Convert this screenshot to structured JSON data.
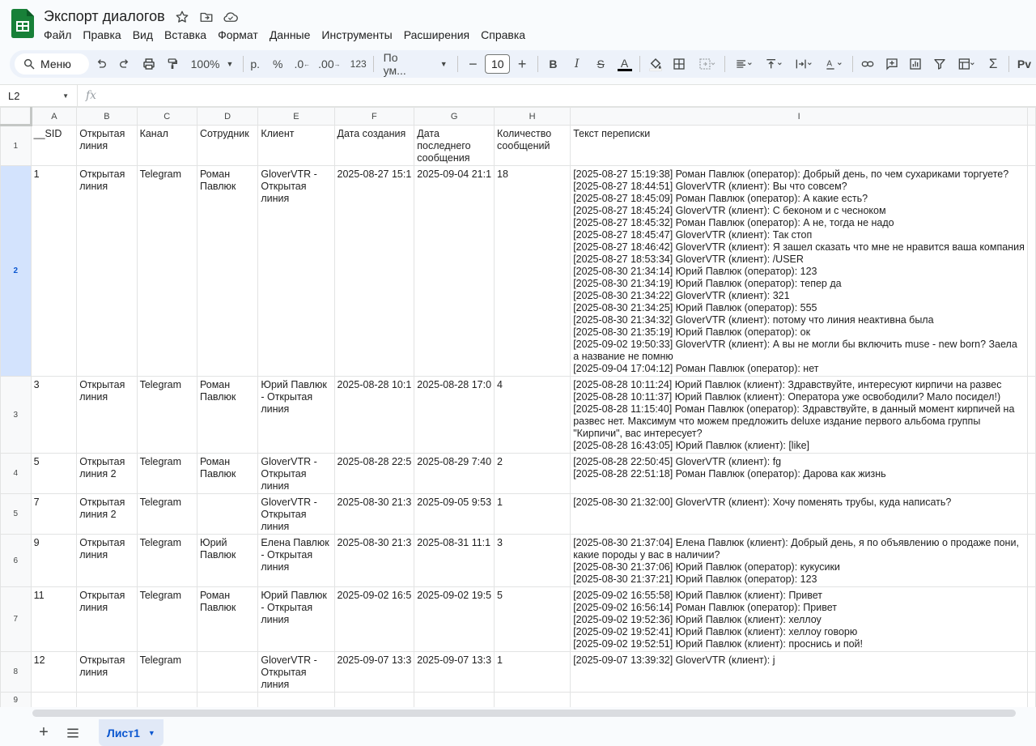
{
  "app": {
    "doc_title": "Экспорт диалогов",
    "brand_color": "#188038"
  },
  "menu": [
    "Файл",
    "Правка",
    "Вид",
    "Вставка",
    "Формат",
    "Данные",
    "Инструменты",
    "Расширения",
    "Справка"
  ],
  "toolbar": {
    "search_label": "Меню",
    "zoom": "100%",
    "currency": "р.",
    "percent": "%",
    "dec_decrease": ".0",
    "dec_increase": ".00",
    "number_format": "123",
    "font_name": "По ум...",
    "font_size": "10"
  },
  "formula_bar": {
    "cell_ref": "L2",
    "fx": "fx"
  },
  "columns": [
    "A",
    "B",
    "C",
    "D",
    "E",
    "F",
    "G",
    "H",
    "I"
  ],
  "header_row": {
    "row_num": "1",
    "cells": [
      "__SID",
      "Открытая линия",
      "Канал",
      "Сотрудник",
      "Клиент",
      "Дата создания",
      "Дата последнего сообщения",
      "Количество сообщений",
      "Текст переписки"
    ]
  },
  "rows": [
    {
      "row_num": "2",
      "sid": "1",
      "line": "Открытая линия",
      "channel": "Telegram",
      "employee": "Роман Павлюк",
      "client": "GloverVTR - Открытая линия",
      "created": "2025-08-27 15:1",
      "last": "2025-09-04 21:1",
      "count": "18",
      "text": [
        "[2025-08-27 15:19:38] Роман Павлюк (оператор): Добрый день, по чем сухариками торгуете?",
        "[2025-08-27 18:44:51] GloverVTR (клиент): Вы что совсем?",
        "[2025-08-27 18:45:09] Роман Павлюк (оператор): А какие есть?",
        "[2025-08-27 18:45:24] GloverVTR (клиент): С беконом и с чесноком",
        "[2025-08-27 18:45:32] Роман Павлюк (оператор): А не, тогда не надо",
        "[2025-08-27 18:45:47] GloverVTR (клиент): Так стоп",
        "[2025-08-27 18:46:42] GloverVTR (клиент): Я зашел сказать что мне не нравится ваша компания",
        "[2025-08-27 18:53:34] GloverVTR (клиент): /USER",
        "[2025-08-30 21:34:14] Юрий Павлюк (оператор): 123",
        "[2025-08-30 21:34:19] Юрий Павлюк (оператор): тепер да",
        "[2025-08-30 21:34:22] GloverVTR (клиент): 321",
        "[2025-08-30 21:34:25] Юрий Павлюк (оператор): 555",
        "[2025-08-30 21:34:32] GloverVTR (клиент): потому что линия неактивна была",
        "[2025-08-30 21:35:19] Юрий Павлюк (оператор): ок",
        "[2025-09-02 19:50:33] GloverVTR (клиент): А вы не могли бы включить muse - new born? Заела а название не помню",
        "[2025-09-04 17:04:12] Роман Павлюк (оператор): нет"
      ]
    },
    {
      "row_num": "3",
      "sid": "3",
      "line": "Открытая линия",
      "channel": "Telegram",
      "employee": "Роман Павлюк",
      "client": "Юрий Павлюк - Открытая линия",
      "created": "2025-08-28 10:1",
      "last": "2025-08-28 17:0",
      "count": "4",
      "text": [
        "[2025-08-28 10:11:24] Юрий Павлюк (клиент): Здравствуйте, интересуют кирпичи на развес",
        "[2025-08-28 10:11:37] Юрий Павлюк (клиент): Оператора уже освободили? Мало посидел!)",
        "[2025-08-28 11:15:40] Роман Павлюк (оператор): Здравствуйте, в данный момент кирпичей на развес нет. Максимум что можем предложить deluxe издание первого альбома группы \"Кирпичи\", вас интересует?",
        "[2025-08-28 16:43:05] Юрий Павлюк (клиент): [like]"
      ]
    },
    {
      "row_num": "4",
      "sid": "5",
      "line": "Открытая линия 2",
      "channel": "Telegram",
      "employee": "Роман Павлюк",
      "client": "GloverVTR - Открытая линия",
      "created": "2025-08-28 22:5",
      "last": "2025-08-29 7:40",
      "count": "2",
      "text": [
        "[2025-08-28 22:50:45] GloverVTR (клиент): fg",
        "[2025-08-28 22:51:18] Роман Павлюк (оператор): Дарова как жизнь"
      ]
    },
    {
      "row_num": "5",
      "sid": "7",
      "line": "Открытая линия 2",
      "channel": "Telegram",
      "employee": "",
      "client": "GloverVTR - Открытая линия",
      "created": "2025-08-30 21:3",
      "last": "2025-09-05 9:53",
      "count": "1",
      "text": [
        "[2025-08-30 21:32:00] GloverVTR (клиент): Хочу поменять трубы, куда написать?"
      ]
    },
    {
      "row_num": "6",
      "sid": "9",
      "line": "Открытая линия",
      "channel": "Telegram",
      "employee": "Юрий Павлюк",
      "client": "Елена Павлюк - Открытая линия",
      "created": "2025-08-30 21:3",
      "last": "2025-08-31 11:1",
      "count": "3",
      "text": [
        "[2025-08-30 21:37:04] Елена Павлюк (клиент): Добрый день, я по объявлению о продаже пони, какие породы у вас в наличии?",
        "[2025-08-30 21:37:06] Юрий Павлюк (оператор): кукусики",
        "[2025-08-30 21:37:21] Юрий Павлюк (оператор): 123"
      ]
    },
    {
      "row_num": "7",
      "sid": "11",
      "line": "Открытая линия",
      "channel": "Telegram",
      "employee": "Роман Павлюк",
      "client": "Юрий Павлюк - Открытая линия",
      "created": "2025-09-02 16:5",
      "last": "2025-09-02 19:5",
      "count": "5",
      "text": [
        "[2025-09-02 16:55:58] Юрий Павлюк (клиент): Привет",
        "[2025-09-02 16:56:14] Роман Павлюк (оператор): Привет",
        "[2025-09-02 19:52:36] Юрий Павлюк (клиент): хеллоу",
        "[2025-09-02 19:52:41] Юрий Павлюк (клиент): хеллоу говорю",
        "[2025-09-02 19:52:51] Юрий Павлюк (клиент): проснись и пой!"
      ]
    },
    {
      "row_num": "8",
      "sid": "12",
      "line": "Открытая линия",
      "channel": "Telegram",
      "employee": "",
      "client": "GloverVTR - Открытая линия",
      "created": "2025-09-07 13:3",
      "last": "2025-09-07 13:3",
      "count": "1",
      "text": [
        "[2025-09-07 13:39:32] GloverVTR (клиент): j"
      ]
    }
  ],
  "empty_rows": [
    "9"
  ],
  "selected_row": "2",
  "sheet_tab": "Лист1"
}
